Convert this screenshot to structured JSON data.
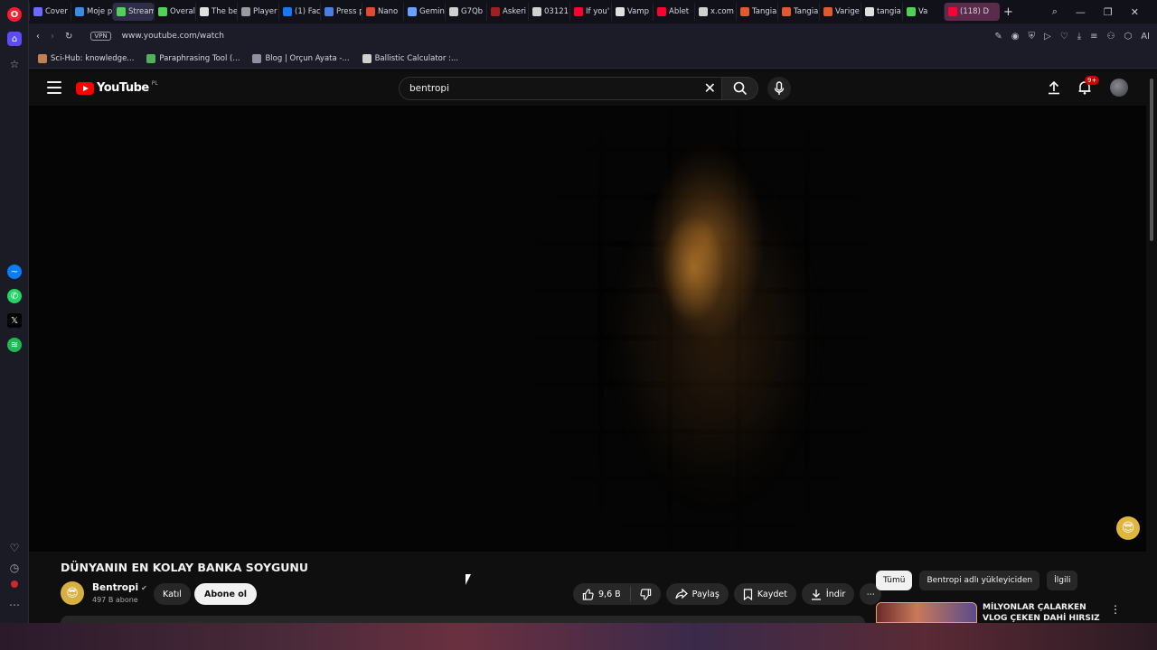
{
  "browser": {
    "tabs": [
      {
        "label": "Cover",
        "color": "#6a6aff"
      },
      {
        "label": "Moje p",
        "color": "#3b8be0"
      },
      {
        "label": "Stream",
        "color": "#53d05a"
      },
      {
        "label": "Overall",
        "color": "#53d05a"
      },
      {
        "label": "The be",
        "color": "#e0e0e0"
      },
      {
        "label": "Player",
        "color": "#9a9aa0"
      },
      {
        "label": "(1) Fac",
        "color": "#1877f2"
      },
      {
        "label": "Press p",
        "color": "#4a7fe0"
      },
      {
        "label": "Nano",
        "color": "#e04a30"
      },
      {
        "label": "Gemin",
        "color": "#6aa0ff"
      },
      {
        "label": "G7Qb",
        "color": "#d0d0d0"
      },
      {
        "label": "Askeri",
        "color": "#a02020"
      },
      {
        "label": "03121",
        "color": "#d0d0d0"
      },
      {
        "label": "If you'",
        "color": "#ff0033"
      },
      {
        "label": "Vamp",
        "color": "#e0e0e0"
      },
      {
        "label": "Ablet",
        "color": "#ff0033"
      },
      {
        "label": "x.com",
        "color": "#d0d0d0"
      },
      {
        "label": "Tangia",
        "color": "#e05a30"
      },
      {
        "label": "Tangia",
        "color": "#e05a30"
      },
      {
        "label": "Varige",
        "color": "#e05a30"
      },
      {
        "label": "tangia",
        "color": "#e0e0e0"
      },
      {
        "label": "Va",
        "color": "#53d05a"
      },
      {
        "label": "(118) D",
        "color": "#ff0033"
      }
    ],
    "url": "www.youtube.com/watch",
    "vpn_label": "VPN",
    "ai_label": "AI",
    "bookmarks": [
      {
        "label": "Sci-Hub: knowledge...",
        "color": "#c08050"
      },
      {
        "label": "Paraphrasing Tool (...",
        "color": "#53b05a"
      },
      {
        "label": "Blog | Orçun Ayata -...",
        "color": "#9090a0"
      },
      {
        "label": "Ballistic Calculator :...",
        "color": "#d0d0d0"
      }
    ]
  },
  "youtube": {
    "logo_text": "YouTube",
    "country_code": "PL",
    "search_value": "bentropi",
    "notification_count": "9+",
    "video": {
      "title": "DÜNYANIN EN KOLAY BANKA SOYGUNU",
      "channel_name": "Bentropi",
      "subscribers": "497 B abone",
      "join_label": "Katıl",
      "subscribe_label": "Abone ol",
      "likes": "9,6 B",
      "share_label": "Paylaş",
      "save_label": "Kaydet",
      "download_label": "İndir"
    },
    "filter_chips": [
      {
        "label": "Tümü",
        "selected": true
      },
      {
        "label": "Bentropi adlı yükleyiciden",
        "selected": false
      },
      {
        "label": "İlgili",
        "selected": false
      }
    ],
    "recommendation": {
      "title": "MİLYONLAR ÇALARKEN VLOG ÇEKEN DAHİ HIRSIZ"
    }
  }
}
